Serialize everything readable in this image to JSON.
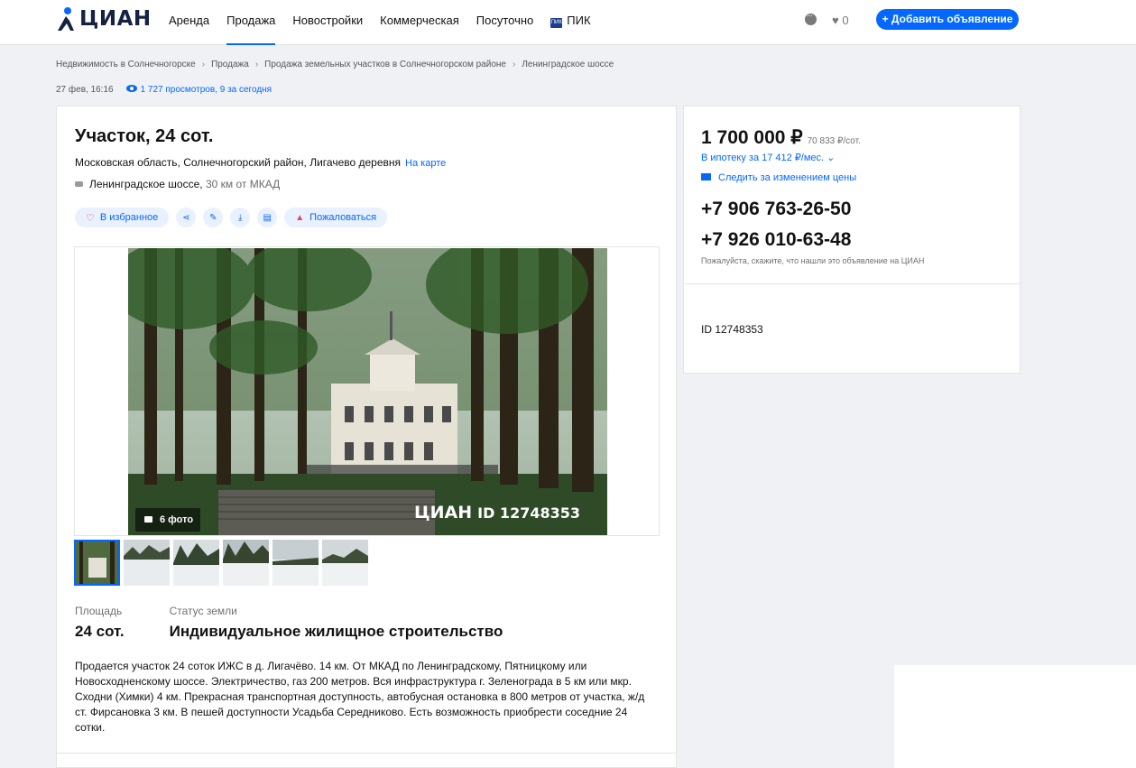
{
  "header": {
    "logo": "ЦИАН",
    "nav": [
      {
        "label": "Аренда",
        "active": false
      },
      {
        "label": "Продажа",
        "active": true
      },
      {
        "label": "Новостройки",
        "active": false
      },
      {
        "label": "Коммерческая",
        "active": false
      },
      {
        "label": "Посуточно",
        "active": false
      },
      {
        "label": "ПИК",
        "active": false,
        "icon": "pik-logo-icon"
      }
    ],
    "favorites_count": "0",
    "add_button": "+ Добавить объявление"
  },
  "breadcrumbs": [
    "Недвижимость в Солнечногорске",
    "Продажа",
    "Продажа земельных участков в Солнечногорском районе",
    "Ленинградское шоссе"
  ],
  "meta": {
    "date": "27 фев, 16:16",
    "views": "1 727 просмотров, 9 за сегодня"
  },
  "listing": {
    "title": "Участок, 24 сот.",
    "address": "Московская область, Солнечногорский район, Лигачево деревня",
    "map_link": "На карте",
    "highway": "Ленинградское шоссе,",
    "distance": "30 км от МКАД",
    "actions": {
      "favorite": "В избранное",
      "complain": "Пожаловаться"
    },
    "photo_count": "6 фото",
    "watermark_brand": "ЦИАН",
    "watermark_id": "ID 12748353",
    "facts": [
      {
        "label": "Площадь",
        "value": "24 сот."
      },
      {
        "label": "Статус земли",
        "value": "Индивидуальное жилищное строительство"
      }
    ],
    "description": "Продается участок 24 соток ИЖС в д. Лигачёво. 14 км. От МКАД по Ленинградскому, Пятницкому или Новосходненскому шоссе. Электричество, газ 200 метров. Вся инфраструктура г. Зеленограда в 5 км или мкр. Сходни (Химки) 4 км. Прекрасная транспортная доступность, автобусная остановка в 800 метров от участка, ж/д ст. Фирсановка 3 км. В пешей доступности Усадьба Середниково. Есть возможность приобрести соседние 24 сотки."
  },
  "sidebar": {
    "price": "1 700 000 ₽",
    "price_per": "70 833 ₽/сот.",
    "mortgage": "В ипотеку за 17 412 ₽/мес.",
    "track_price": "Следить за изменением цены",
    "phones": [
      "+7 906 763-26-50",
      "+7 926 010-63-48"
    ],
    "hint": "Пожалуйста, скажите, что нашли это объявление на ЦИАН",
    "listing_id": "ID 12748353"
  },
  "colors": {
    "accent": "#0468ff",
    "background": "#f0f1f4",
    "text": "#121212"
  }
}
